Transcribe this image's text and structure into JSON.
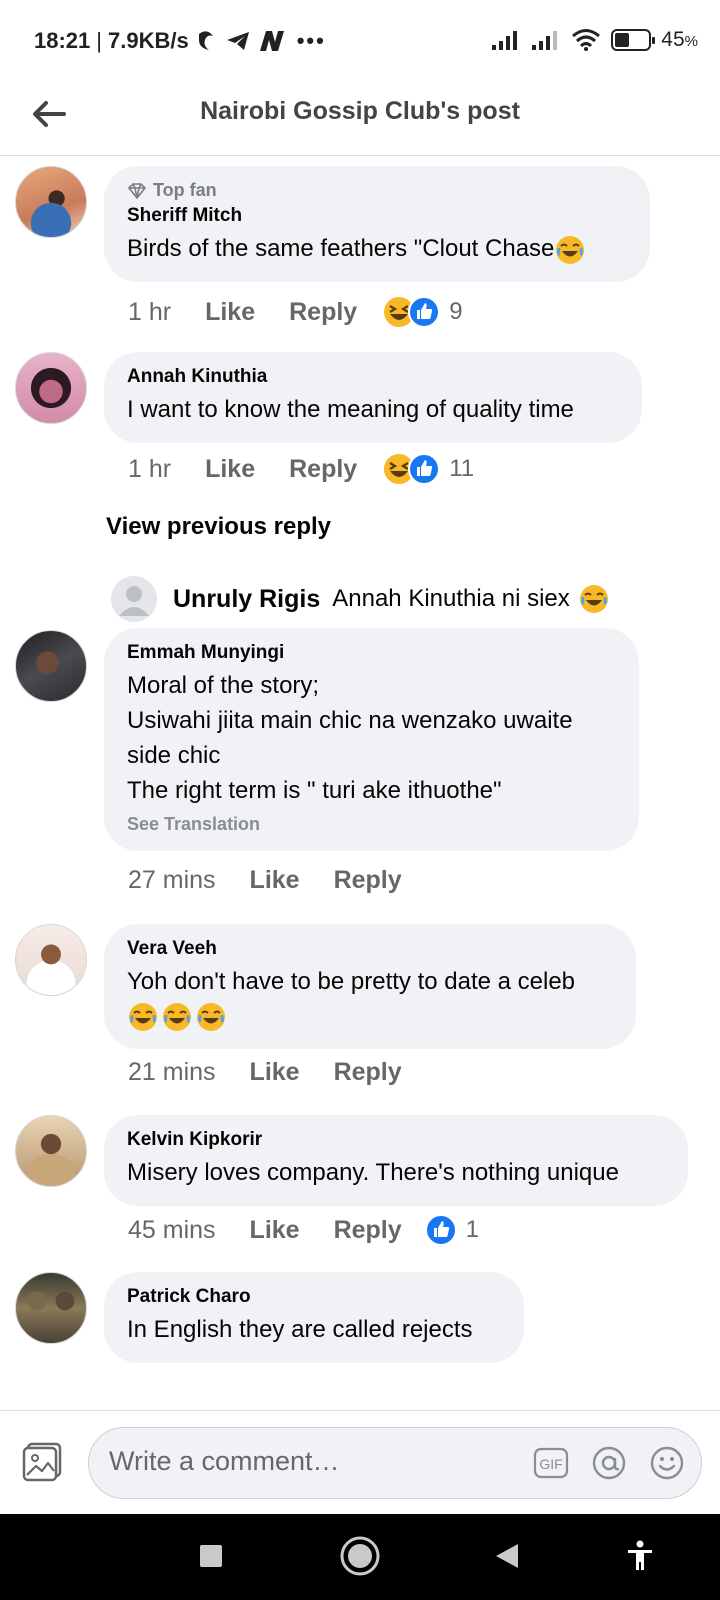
{
  "status": {
    "time": "18:21",
    "speed": "7.9KB/s",
    "battery": "45",
    "battery_level": 0.45
  },
  "header": {
    "title": "Nairobi Gossip Club's post"
  },
  "comments": [
    {
      "badge": "Top fan",
      "author": "Sheriff Mitch",
      "text": "Birds of the same feathers \"Clout Chase",
      "trailing_emojis": 1,
      "time": "1 hr",
      "like": "Like",
      "reply": "Reply",
      "reactions": [
        "haha",
        "like"
      ],
      "reaction_count": "9"
    },
    {
      "author": "Annah Kinuthia",
      "text": "I want to know the meaning of quality time",
      "time": "1 hr",
      "like": "Like",
      "reply": "Reply",
      "reactions": [
        "haha",
        "like"
      ],
      "reaction_count": "11"
    },
    {
      "author": "Emmah Munyingi",
      "text": "Moral of the story;\nUsiwahi jiita main chic na wenzako uwaite side chic\nThe right term is \" turi ake ithuothe\"",
      "see_translation": "See Translation",
      "time": "27 mins",
      "like": "Like",
      "reply": "Reply"
    },
    {
      "author": "Vera Veeh",
      "text": "Yoh don't have to be pretty to date a celeb",
      "emoji_line_count": 3,
      "time": "21 mins",
      "like": "Like",
      "reply": "Reply"
    },
    {
      "author": "Kelvin Kipkorir",
      "text": "Misery loves company. There's nothing unique",
      "time": "45 mins",
      "like": "Like",
      "reply": "Reply",
      "reactions": [
        "like"
      ],
      "reaction_count": "1"
    },
    {
      "author": "Patrick Charo",
      "text": "In English they are called rejects"
    }
  ],
  "view_previous_reply": "View previous reply",
  "nested_reply": {
    "author": "Unruly Rigis",
    "text": "Annah Kinuthia ni siex"
  },
  "composer": {
    "placeholder": "Write a comment…",
    "gif_label": "GIF"
  },
  "colors": {
    "bubble": "#f0f2f5",
    "like_blue": "#1877f2",
    "haha_yellow": "#f7b928",
    "meta_gray": "#65676b"
  }
}
